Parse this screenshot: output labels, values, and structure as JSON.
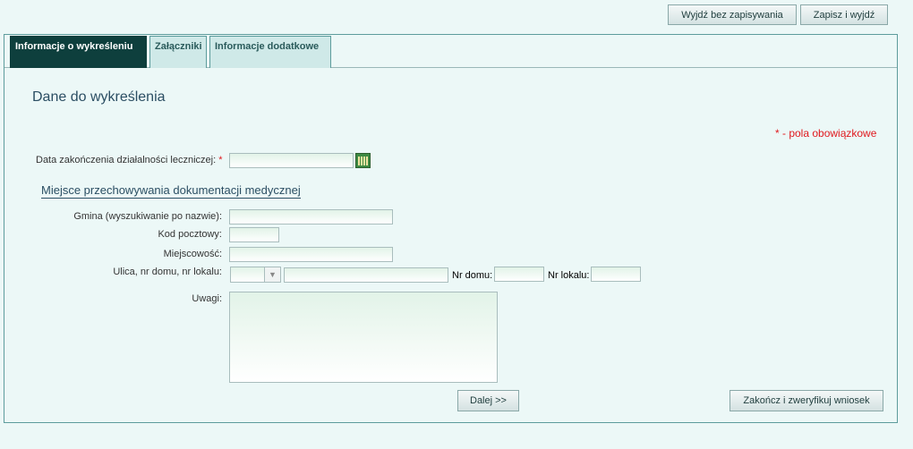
{
  "toolbar": {
    "exit_without_saving": "Wyjdź bez zapisywania",
    "save_and_exit": "Zapisz i wyjdź"
  },
  "tabs": [
    {
      "label": "Informacje o wykreśleniu",
      "active": true
    },
    {
      "label": "Załączniki",
      "active": false
    },
    {
      "label": "Informacje dodatkowe",
      "active": false
    }
  ],
  "form": {
    "title": "Dane do wykreślenia",
    "required_note": "* - pola obowiązkowe",
    "end_date_label": "Data zakończenia działalności leczniczej:",
    "required_marker": "*",
    "end_date_value": "",
    "section_title": "Miejsce przechowywania dokumentacji medycznej",
    "gmina_label": "Gmina (wyszukiwanie po nazwie):",
    "gmina_value": "",
    "postal_label": "Kod pocztowy:",
    "postal_value": "",
    "city_label": "Miejscowość:",
    "city_value": "",
    "street_label": "Ulica, nr domu, nr lokalu:",
    "street_prefix_value": "",
    "street_value": "",
    "house_no_label": "Nr domu:",
    "house_no_value": "",
    "apt_no_label": "Nr lokalu:",
    "apt_no_value": "",
    "notes_label": "Uwagi:",
    "notes_value": ""
  },
  "actions": {
    "next": "Dalej >>",
    "finish": "Zakończ i zweryfikuj wniosek"
  },
  "colors": {
    "background": "#ecf8f7",
    "active_tab": "#0e3f3d",
    "inactive_tab": "#cfe9e8",
    "required": "#e0191e",
    "heading": "#2b4e63"
  }
}
